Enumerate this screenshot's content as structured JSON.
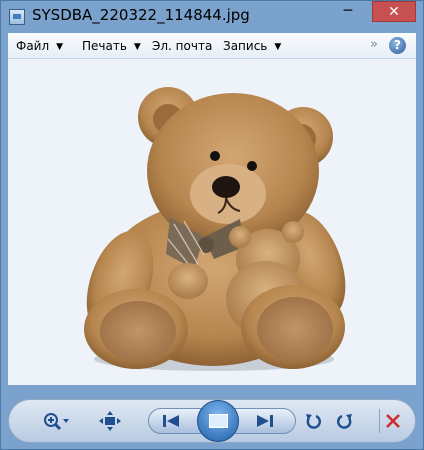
{
  "window": {
    "title": "SYSDBA_220322_114844.jpg"
  },
  "menu": {
    "items": [
      {
        "label": "Файл",
        "has_dropdown": true
      },
      {
        "label": "Печать",
        "has_dropdown": true
      },
      {
        "label": "Эл. почта",
        "has_dropdown": false
      },
      {
        "label": "Запись",
        "has_dropdown": true
      }
    ]
  },
  "viewer": {
    "image_subject": "teddy bear holding small teddy bear"
  },
  "toolbar": {
    "buttons": [
      "zoom-icon",
      "fit-window-icon",
      "previous-icon",
      "slideshow-icon",
      "next-icon",
      "rotate-left-icon",
      "rotate-right-icon",
      "delete-icon"
    ]
  },
  "colors": {
    "accent": "#2c5f9c",
    "close": "#c75050",
    "delete": "#d02a2a"
  }
}
